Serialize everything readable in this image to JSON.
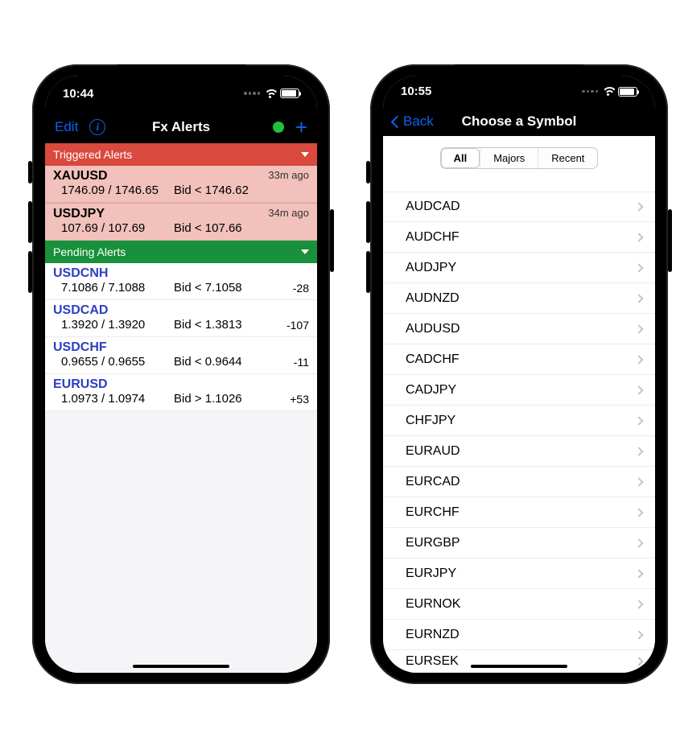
{
  "phone1": {
    "status_time": "10:44",
    "nav": {
      "edit": "Edit",
      "title": "Fx Alerts"
    },
    "sections": {
      "triggered": "Triggered Alerts",
      "pending": "Pending Alerts"
    },
    "triggered": [
      {
        "sym": "XAUUSD",
        "quotes": "1746.09 / 1746.65",
        "cond": "Bid < 1746.62",
        "time": "33m ago"
      },
      {
        "sym": "USDJPY",
        "quotes": "107.69 / 107.69",
        "cond": "Bid < 107.66",
        "time": "34m ago"
      }
    ],
    "pending": [
      {
        "sym": "USDCNH",
        "quotes": "7.1086 / 7.1088",
        "cond": "Bid < 7.1058",
        "delta": "-28"
      },
      {
        "sym": "USDCAD",
        "quotes": "1.3920 / 1.3920",
        "cond": "Bid < 1.3813",
        "delta": "-107"
      },
      {
        "sym": "USDCHF",
        "quotes": "0.9655 / 0.9655",
        "cond": "Bid < 0.9644",
        "delta": "-11"
      },
      {
        "sym": "EURUSD",
        "quotes": "1.0973 / 1.0974",
        "cond": "Bid > 1.1026",
        "delta": "+53"
      }
    ]
  },
  "phone2": {
    "status_time": "10:55",
    "nav": {
      "back": "Back",
      "title": "Choose a Symbol"
    },
    "tabs": {
      "all": "All",
      "majors": "Majors",
      "recent": "Recent"
    },
    "symbols": [
      "AUDCAD",
      "AUDCHF",
      "AUDJPY",
      "AUDNZD",
      "AUDUSD",
      "CADCHF",
      "CADJPY",
      "CHFJPY",
      "EURAUD",
      "EURCAD",
      "EURCHF",
      "EURGBP",
      "EURJPY",
      "EURNOK",
      "EURNZD",
      "EURSEK"
    ]
  }
}
